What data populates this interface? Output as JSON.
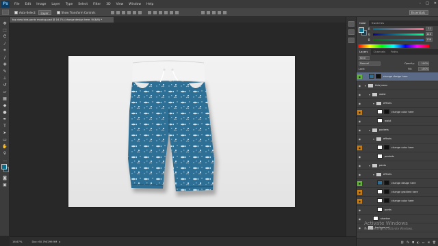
{
  "menubar": {
    "logo": "Ps",
    "items": [
      "File",
      "Edit",
      "Image",
      "Layer",
      "Type",
      "Select",
      "Filter",
      "3D",
      "View",
      "Window",
      "Help"
    ],
    "window_controls": [
      "–",
      "□",
      "✕"
    ]
  },
  "options": {
    "auto_select_label": "Auto-Select:",
    "auto_select_value": "Layer",
    "transform_label": "Show Transform Controls",
    "workspace": "Essentials"
  },
  "document": {
    "tab_title": "top view kids pants mockup.psd @ 16.7% (change design here, RGB/8) *"
  },
  "status": {
    "zoom": "16.67%",
    "doc_size": "Doc: 60.7M/299.9M"
  },
  "colors": {
    "foreground": "#0b6e8a",
    "background": "#1f3d4a",
    "accent": "#f07a1a",
    "pants_blue": "#2e6f95",
    "waistband": "#f3f3f3",
    "selected_row": "#5b6a86"
  },
  "color_panel": {
    "tabs": [
      "Color",
      "Swatches"
    ],
    "sliders": [
      {
        "label": "R",
        "value": "11"
      },
      {
        "label": "G",
        "value": "110"
      },
      {
        "label": "B",
        "value": "138"
      }
    ]
  },
  "layers_panel": {
    "tabs": [
      "Layers",
      "Channels",
      "Paths"
    ],
    "kind": "Kind",
    "blend": "Normal",
    "opacity_label": "Opacity:",
    "opacity": "100%",
    "fill_label": "Fill:",
    "fill": "100%",
    "lock_label": "Lock:",
    "rows": [
      {
        "name": "change design here",
        "indent": 0,
        "kind": "smart",
        "selected": true,
        "mark": "#61b33a"
      },
      {
        "name": "kids jeans",
        "indent": 0,
        "kind": "group",
        "selected": false,
        "mark": ""
      },
      {
        "name": "waist",
        "indent": 1,
        "kind": "group",
        "selected": false,
        "mark": ""
      },
      {
        "name": "effects",
        "indent": 2,
        "kind": "group",
        "selected": false,
        "mark": ""
      },
      {
        "name": "change color here",
        "indent": 2,
        "kind": "mask",
        "selected": false,
        "mark": "#c77b13"
      },
      {
        "name": "waist",
        "indent": 2,
        "kind": "layer",
        "selected": false,
        "mark": ""
      },
      {
        "name": "pockets",
        "indent": 1,
        "kind": "group",
        "selected": false,
        "mark": ""
      },
      {
        "name": "effects",
        "indent": 2,
        "kind": "group",
        "selected": false,
        "mark": ""
      },
      {
        "name": "change color here",
        "indent": 2,
        "kind": "mask",
        "selected": false,
        "mark": "#c77b13"
      },
      {
        "name": "pockets",
        "indent": 2,
        "kind": "layer",
        "selected": false,
        "mark": ""
      },
      {
        "name": "pants",
        "indent": 1,
        "kind": "group",
        "selected": false,
        "mark": ""
      },
      {
        "name": "effects",
        "indent": 2,
        "kind": "group",
        "selected": false,
        "mark": ""
      },
      {
        "name": "change design here",
        "indent": 2,
        "kind": "smart",
        "selected": false,
        "mark": "#61b33a"
      },
      {
        "name": "change gradient here",
        "indent": 2,
        "kind": "mask",
        "selected": false,
        "mark": "#c77b13"
      },
      {
        "name": "change color here",
        "indent": 2,
        "kind": "mask",
        "selected": false,
        "mark": "#c77b13"
      },
      {
        "name": "pants",
        "indent": 2,
        "kind": "layer",
        "selected": false,
        "mark": ""
      },
      {
        "name": "shadow",
        "indent": 1,
        "kind": "layer",
        "selected": false,
        "mark": ""
      },
      {
        "name": "background",
        "indent": 0,
        "kind": "group",
        "selected": false,
        "mark": ""
      }
    ]
  },
  "watermark": {
    "title": "Activate Windows",
    "subtitle": "Go to Settings to activate Windows."
  }
}
